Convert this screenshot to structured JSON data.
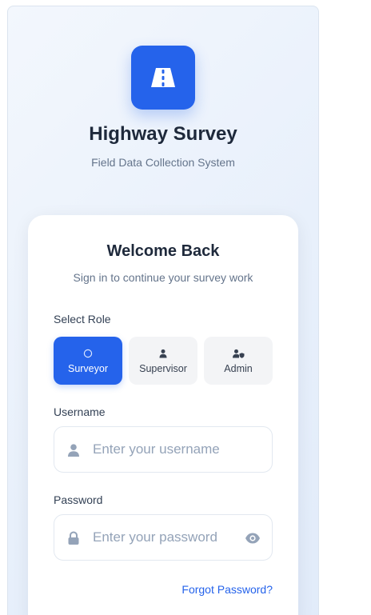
{
  "app": {
    "title": "Highway Survey",
    "subtitle": "Field Data Collection System",
    "logo_icon": "road-icon",
    "accent_color": "#2563eb"
  },
  "login": {
    "heading": "Welcome Back",
    "subheading": "Sign in to continue your survey work",
    "role_label": "Select Role",
    "roles": [
      {
        "label": "Surveyor",
        "icon": "circle-icon",
        "selected": true
      },
      {
        "label": "Supervisor",
        "icon": "user-icon",
        "selected": false
      },
      {
        "label": "Admin",
        "icon": "user-shield-icon",
        "selected": false
      }
    ],
    "username": {
      "label": "Username",
      "placeholder": "Enter your username",
      "value": "",
      "icon": "user-icon"
    },
    "password": {
      "label": "Password",
      "placeholder": "Enter your password",
      "value": "",
      "icon": "lock-icon",
      "toggle_icon": "eye-icon"
    },
    "forgot_password": "Forgot Password?"
  }
}
